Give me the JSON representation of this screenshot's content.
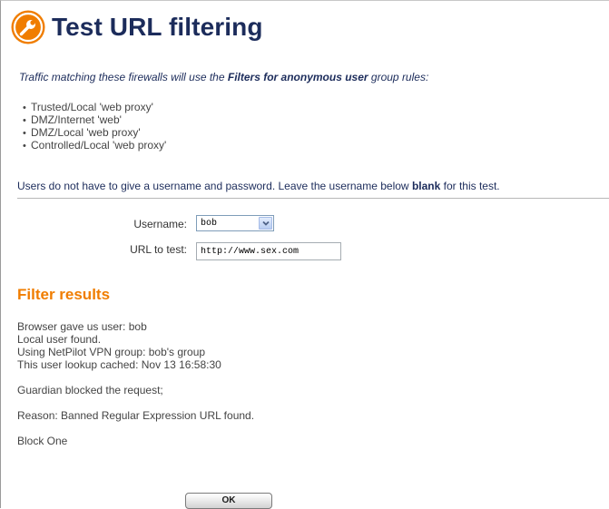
{
  "header": {
    "title": "Test URL filtering",
    "logo_icon": "wrench-icon",
    "logo_color": "#f07d00"
  },
  "intro": {
    "prefix": "Traffic matching these firewalls will use the ",
    "bold": "Filters for anonymous user",
    "suffix": " group rules:"
  },
  "firewalls": [
    "Trusted/Local 'web proxy'",
    "DMZ/Internet 'web'",
    "DMZ/Local 'web proxy'",
    "Controlled/Local 'web proxy'"
  ],
  "note": {
    "prefix": "Users do not have to give a username and password. Leave the username below ",
    "bold": "blank",
    "suffix": " for this test."
  },
  "form": {
    "username_label": "Username:",
    "username_value": "bob",
    "url_label": "URL to test:",
    "url_value": "http://www.sex.com"
  },
  "results": {
    "title": "Filter results",
    "lines": [
      "Browser gave us user: bob",
      "Local user found.",
      "Using NetPilot VPN group: bob's group",
      "This user lookup cached: Nov 13 16:58:30",
      "",
      "Guardian blocked the request;",
      "",
      "Reason: Banned Regular Expression URL found.",
      "",
      "Block One"
    ]
  },
  "ok_label": "OK",
  "colors": {
    "title": "#1c2c5b",
    "accent": "#f07d00",
    "body_text": "#444444"
  }
}
